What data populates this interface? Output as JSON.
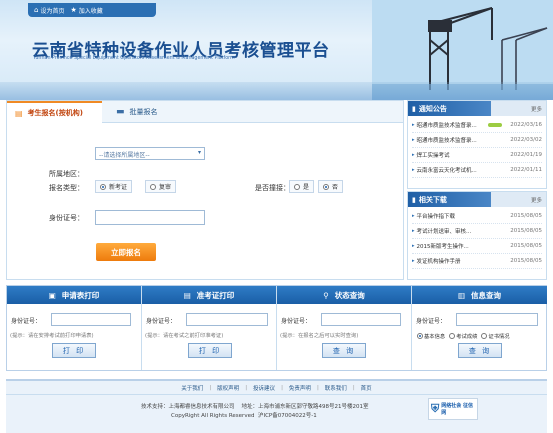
{
  "header": {
    "set_home": "设为首页",
    "add_favorite": "加入收藏",
    "title": "云南省特种设备作业人员考核管理平台",
    "subtitle": "Yunnan Province Special Equipment Operators Assessment & Management Platform"
  },
  "registration": {
    "tab_active": "考生报名(按机构)",
    "tab_batch": "批量报名",
    "region_label": "所属地区：",
    "region_select": "--请选择所属地区--",
    "type_label": "报名类型：",
    "type_new": "新考证",
    "type_renew": "复审",
    "practice_label": "是否撞接：",
    "practice_yes": "是",
    "practice_no": "否",
    "id_label": "身份证号：",
    "submit": "立即报名"
  },
  "notice": {
    "title": "通知公告",
    "more": "更多",
    "items": [
      {
        "text": "昭通市质监技术监督录...",
        "date": "2022/03/16"
      },
      {
        "text": "昭通市质监技术监督录...",
        "date": "2022/03/02"
      },
      {
        "text": "焊工实操考试",
        "date": "2022/01/19"
      },
      {
        "text": "云南永富云天化考试机...",
        "date": "2022/01/11"
      }
    ]
  },
  "downloads": {
    "title": "相关下载",
    "more": "更多",
    "items": [
      {
        "text": "平台操作指下载",
        "date": "2015/08/05"
      },
      {
        "text": "考试计划送审、审核...",
        "date": "2015/08/05"
      },
      {
        "text": "2015新版考生操作...",
        "date": "2015/08/05"
      },
      {
        "text": "发证机构操作手册",
        "date": "2015/08/05"
      }
    ]
  },
  "query": {
    "apply_print": {
      "title": "申请表打印",
      "label": "身份证号：",
      "tip": "(提示：请在安排考试前打印申请表)",
      "button": "打 印"
    },
    "admit_print": {
      "title": "准考证打印",
      "label": "身份证号：",
      "tip": "(提示：请在考试之前打印准考证)",
      "button": "打 印"
    },
    "status": {
      "title": "状态查询",
      "label": "身份证号：",
      "tip": "(提示：在报名之后可以实时查询)",
      "button": "查 询"
    },
    "info": {
      "title": "信息查询",
      "label": "身份证号：",
      "opt_basic": "基本信息",
      "opt_score": "考试成绩",
      "opt_cert": "证书情况",
      "button": "查 询"
    }
  },
  "footer": {
    "links": [
      "关于我们",
      "版权声明",
      "投诉建议",
      "免责声明",
      "联系我们",
      "首页"
    ],
    "support": "技术支持：上海都睿信息技术有限公司",
    "address": "地址：上海市浦东新区郭守敬路498号21号楼201室",
    "copyright": "CopyRight All Rights Reserved",
    "icp": "沪ICP备07004022号-1",
    "badge": "网络社会 征信网"
  }
}
